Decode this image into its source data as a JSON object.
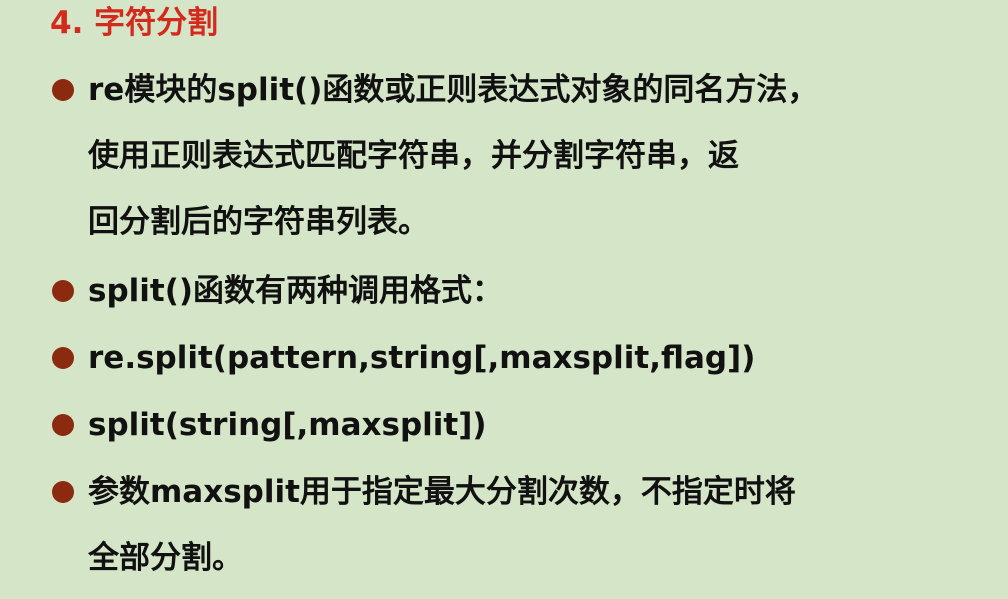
{
  "heading": "4. 字符分割",
  "bullets": [
    {
      "lines": [
        "re模块的split()函数或正则表达式对象的同名方法，",
        "使用正则表达式匹配字符串，并分割字符串，返",
        "回分割后的字符串列表。"
      ]
    },
    {
      "lines": [
        "split()函数有两种调用格式："
      ]
    },
    {
      "lines": [
        "re.split(pattern,string[,maxsplit,flag])"
      ]
    },
    {
      "lines": [
        "split(string[,maxsplit])"
      ]
    },
    {
      "lines": [
        "参数maxsplit用于指定最大分割次数，不指定时将",
        "全部分割。"
      ]
    }
  ],
  "colors": {
    "background": "#d5e5c8",
    "heading": "#d42a1e",
    "bullet": "#8b2a0f",
    "text": "#111111"
  }
}
